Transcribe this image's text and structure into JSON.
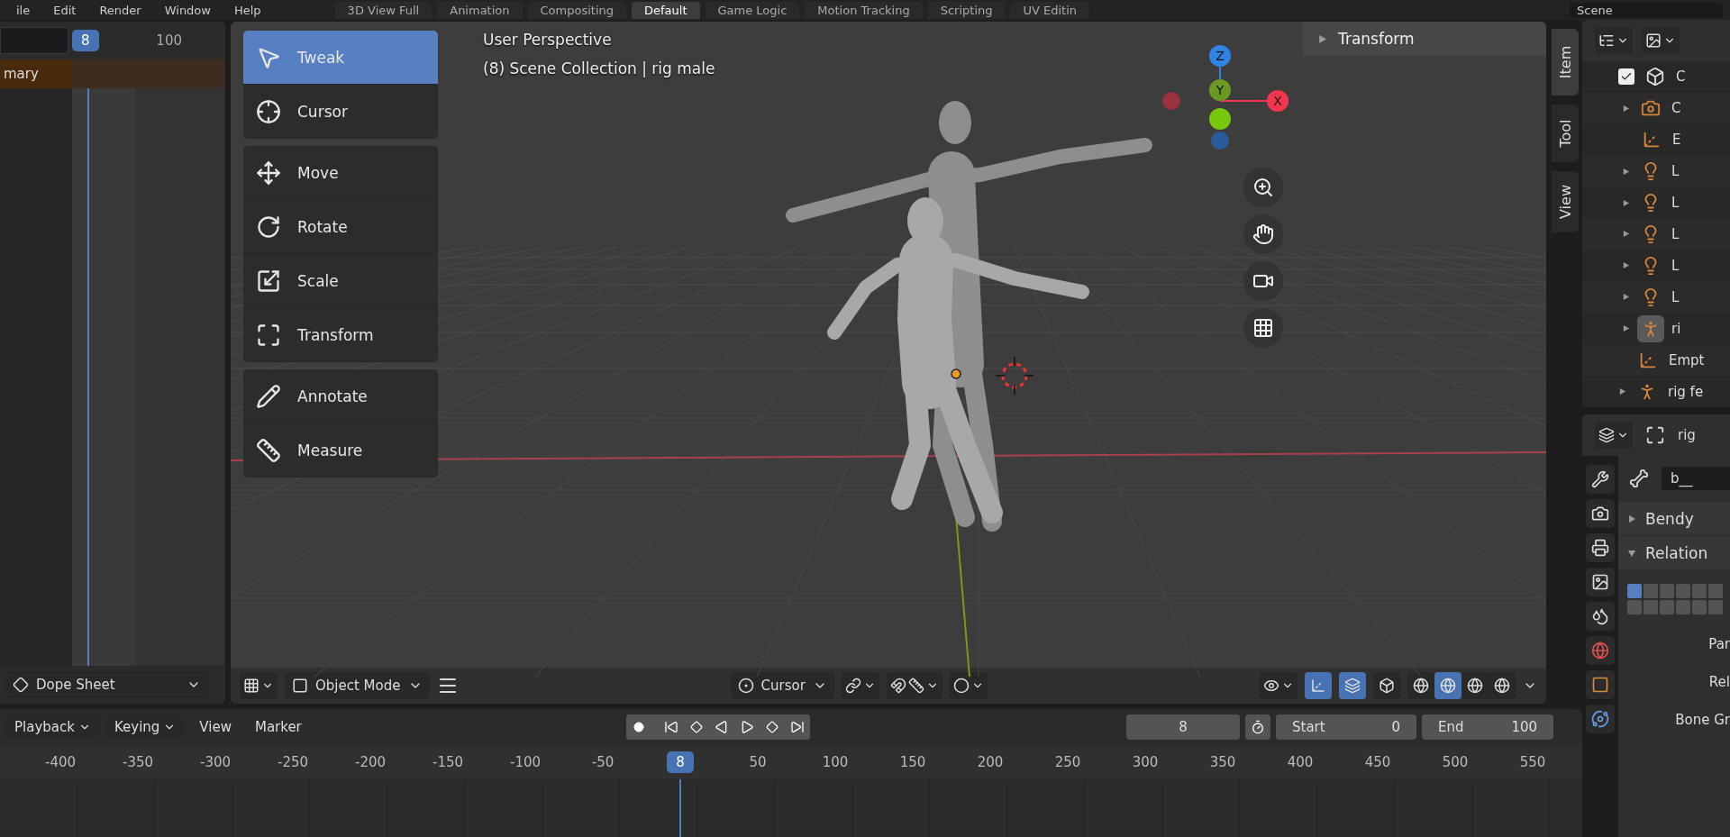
{
  "menu": [
    "ile",
    "Edit",
    "Render",
    "Window",
    "Help"
  ],
  "workspaces": [
    {
      "label": "3D View Full",
      "selected": false
    },
    {
      "label": "Animation",
      "selected": false
    },
    {
      "label": "Compositing",
      "selected": false
    },
    {
      "label": "Default",
      "selected": true
    },
    {
      "label": "Game Logic",
      "selected": false
    },
    {
      "label": "Motion Tracking",
      "selected": false
    },
    {
      "label": "Scripting",
      "selected": false
    },
    {
      "label": "UV Editin",
      "selected": false
    }
  ],
  "scene": "Scene",
  "dope_sheet": {
    "current_frame": "8",
    "end_frame": "100",
    "channel": "mary",
    "editor": "Dope Sheet"
  },
  "toolbar": {
    "groups": [
      [
        {
          "label": "Tweak",
          "selected": true
        },
        {
          "label": "Cursor",
          "selected": false
        }
      ],
      [
        {
          "label": "Move",
          "selected": false
        },
        {
          "label": "Rotate",
          "selected": false
        },
        {
          "label": "Scale",
          "selected": false
        },
        {
          "label": "Transform",
          "selected": false
        }
      ],
      [
        {
          "label": "Annotate",
          "selected": false
        },
        {
          "label": "Measure",
          "selected": false
        }
      ]
    ]
  },
  "viewport": {
    "view_name": "User Perspective",
    "object_info": "(8) Scene Collection | rig male",
    "gizmo_axes": [
      "Z",
      "Y",
      "X"
    ]
  },
  "sidebar": {
    "panel": "Transform",
    "tabs": [
      {
        "label": "Item",
        "selected": true
      },
      {
        "label": "Tool",
        "selected": false
      },
      {
        "label": "View",
        "selected": false
      }
    ]
  },
  "viewport_header": {
    "mode": "Object Mode",
    "pivot": "Cursor",
    "gizmos_on": true,
    "overlays_on": true,
    "shading_modes": [
      {
        "selected": false
      },
      {
        "selected": true
      },
      {
        "selected": false
      },
      {
        "selected": false
      }
    ]
  },
  "timeline": {
    "menus": [
      {
        "label": "Playback",
        "dropdown": true
      },
      {
        "label": "Keying",
        "dropdown": true
      },
      {
        "label": "View",
        "dropdown": false
      },
      {
        "label": "Marker",
        "dropdown": false
      }
    ],
    "current_frame": "8",
    "ruler_frame": "8",
    "start_label": "Start",
    "start": "0",
    "end_label": "End",
    "end": "100",
    "ticks_before": [
      "-400",
      "-350",
      "-300",
      "-250",
      "-200",
      "-150",
      "-100",
      "-50"
    ],
    "ticks_after": [
      "50",
      "100",
      "150",
      "200",
      "250",
      "300",
      "350",
      "400",
      "450",
      "500",
      "550"
    ]
  },
  "outliner": {
    "rows": [
      {
        "kind": "collection",
        "label": "C",
        "checked": true,
        "active": false,
        "children": [
          {
            "kind": "camera",
            "label": "C",
            "active": false
          },
          {
            "kind": "empty",
            "label": "E",
            "active": false
          },
          {
            "kind": "light",
            "label": "L",
            "active": false
          },
          {
            "kind": "light",
            "label": "L",
            "active": false
          },
          {
            "kind": "light",
            "label": "L",
            "active": false
          },
          {
            "kind": "light",
            "label": "L",
            "active": false
          },
          {
            "kind": "light",
            "label": "L",
            "active": false
          },
          {
            "kind": "armature",
            "label": "ri",
            "active": true
          }
        ]
      },
      {
        "kind": "empty",
        "label": "Empt",
        "active": false
      },
      {
        "kind": "armature",
        "label": "rig fe",
        "active": false
      }
    ]
  },
  "properties": {
    "object": "rig",
    "bone": "b__",
    "panels": [
      {
        "label": "Bendy",
        "expanded": false
      },
      {
        "label": "Relation",
        "expanded": true
      }
    ],
    "layers": [
      {
        "selected": true
      },
      {
        "selected": false
      },
      {
        "selected": false
      },
      {
        "selected": false
      },
      {
        "selected": false
      },
      {
        "selected": false
      },
      {
        "selected": false
      },
      {
        "selected": false
      },
      {
        "selected": false
      },
      {
        "selected": false
      },
      {
        "selected": false
      },
      {
        "selected": false
      }
    ],
    "fields": [
      "Par",
      "Rel",
      "Bone Gr"
    ]
  }
}
